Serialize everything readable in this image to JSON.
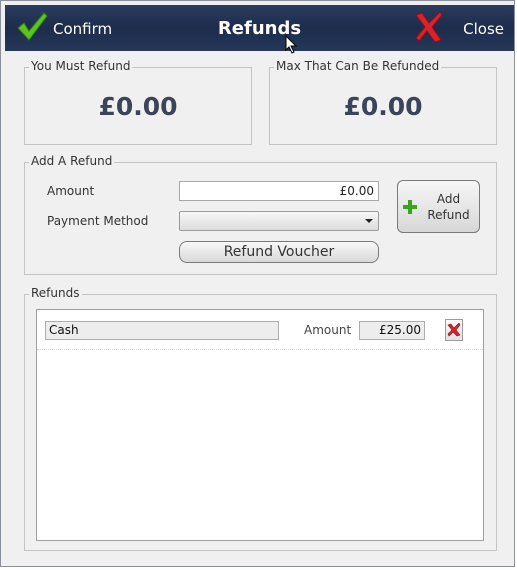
{
  "window": {
    "title": "Refunds"
  },
  "toolbar": {
    "confirm_label": "Confirm",
    "close_label": "Close",
    "confirm_icon": "checkmark-icon",
    "close_icon": "red-x-icon"
  },
  "summary": {
    "must_refund_label": "You Must Refund",
    "must_refund_value": "£0.00",
    "max_refund_label": "Max That Can Be Refunded",
    "max_refund_value": "£0.00"
  },
  "add_refund": {
    "group_label": "Add A Refund",
    "amount_label": "Amount",
    "amount_value": "£0.00",
    "payment_method_label": "Payment Method",
    "payment_method_value": "",
    "voucher_button": "Refund Voucher",
    "add_button_line1": "Add",
    "add_button_line2": "Refund",
    "add_icon": "green-plus-icon"
  },
  "refunds": {
    "group_label": "Refunds",
    "items": [
      {
        "method": "Cash",
        "amount_label": "Amount",
        "amount": "£25.00",
        "delete_icon": "red-x-icon"
      }
    ]
  },
  "colors": {
    "titlebar": "#1d2c4b",
    "confirm_green": "#4caf1a",
    "close_red": "#d0202a",
    "big_amount": "#3c4457"
  }
}
